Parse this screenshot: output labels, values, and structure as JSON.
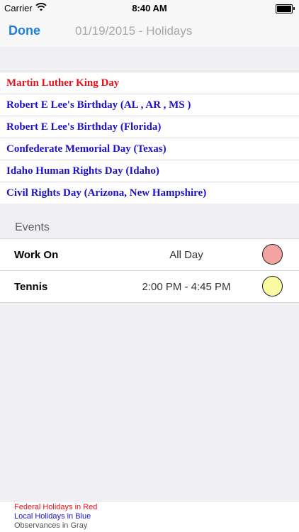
{
  "status_bar": {
    "carrier": "Carrier",
    "time": "8:40 AM",
    "wifi_icon": "wifi-icon",
    "battery_icon": "battery-icon"
  },
  "nav": {
    "done_label": "Done",
    "title": "01/19/2015 - Holidays"
  },
  "colors": {
    "federal": "#e8101a",
    "local": "#1c11c8",
    "observance": "#555555",
    "accent": "#1d7ee0",
    "work_on_dot": "#f4a3a3",
    "tennis_dot": "#fafaa0"
  },
  "holidays": [
    {
      "name": "Martin Luther King Day",
      "kind": "federal"
    },
    {
      "name": "Robert E Lee's Birthday (AL , AR , MS )",
      "kind": "local"
    },
    {
      "name": "Robert E Lee's Birthday (Florida)",
      "kind": "local"
    },
    {
      "name": "Confederate Memorial Day (Texas)",
      "kind": "local"
    },
    {
      "name": "Idaho Human Rights Day (Idaho)",
      "kind": "local"
    },
    {
      "name": "Civil Rights Day (Arizona, New Hampshire)",
      "kind": "local"
    }
  ],
  "events_header": "Events",
  "events": [
    {
      "name": "Work On",
      "time": "All Day",
      "color": "#f4a3a3"
    },
    {
      "name": "Tennis",
      "time": "2:00 PM - 4:45 PM",
      "color": "#fafaa0"
    }
  ],
  "legend": {
    "federal": "Federal Holidays in Red",
    "local": "Local Holidays in Blue",
    "observance": "Observances in Gray"
  }
}
